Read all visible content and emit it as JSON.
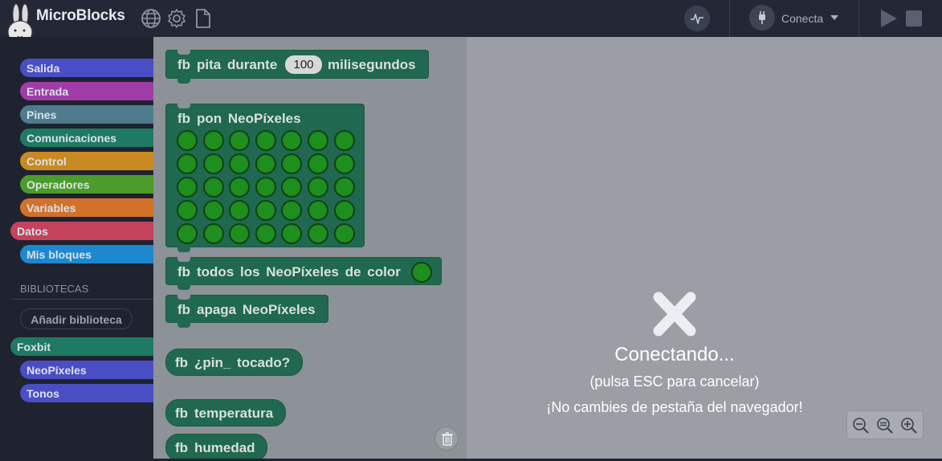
{
  "app": {
    "title": "MicroBlocks"
  },
  "toolbar": {
    "connect_label": "Conecta",
    "icons": [
      "globe-icon",
      "gear-icon",
      "file-icon",
      "pulse-icon",
      "plug-icon",
      "play-icon",
      "stop-icon"
    ]
  },
  "sidebar": {
    "categories": [
      {
        "label": "Salida",
        "color": "#4a4ec4"
      },
      {
        "label": "Entrada",
        "color": "#a03ba8"
      },
      {
        "label": "Pines",
        "color": "#4e7c8c"
      },
      {
        "label": "Comunicaciones",
        "color": "#1f7a63"
      },
      {
        "label": "Control",
        "color": "#c98a22"
      },
      {
        "label": "Operadores",
        "color": "#4b9c2a"
      },
      {
        "label": "Variables",
        "color": "#d2712a"
      },
      {
        "label": "Datos",
        "color": "#c4425c"
      },
      {
        "label": "Mis bloques",
        "color": "#1e88cf"
      }
    ],
    "libraries_heading": "BIBLIOTECAS",
    "add_library_label": "Añadir biblioteca",
    "libraries": [
      {
        "label": "Foxbit",
        "color": "#1f7a63"
      },
      {
        "label": "NeoPíxeles",
        "color": "#4a4ec4"
      },
      {
        "label": "Tonos",
        "color": "#4a4ec4"
      }
    ]
  },
  "palette": {
    "beep_block": {
      "prefix": "fb",
      "text1": "pita durante",
      "value": "100",
      "text2": "milisegundos"
    },
    "neopixels_block": {
      "prefix": "fb",
      "text": "pon NeoPíxeles"
    },
    "all_color_block": {
      "prefix": "fb",
      "text": "todos los NeoPíxeles de color"
    },
    "off_block": {
      "prefix": "fb",
      "text": "apaga NeoPíxeles"
    },
    "touched_block": {
      "prefix": "fb",
      "text": "¿pin_ tocado?"
    },
    "temperature_block": {
      "prefix": "fb",
      "text": "temperatura"
    },
    "humidity_block": {
      "prefix": "fb",
      "text": "humedad"
    }
  },
  "overlay": {
    "title": "Conectando...",
    "subtitle": "(pulsa ESC para cancelar)",
    "warning": "¡No cambies de pestaña del navegador!"
  }
}
